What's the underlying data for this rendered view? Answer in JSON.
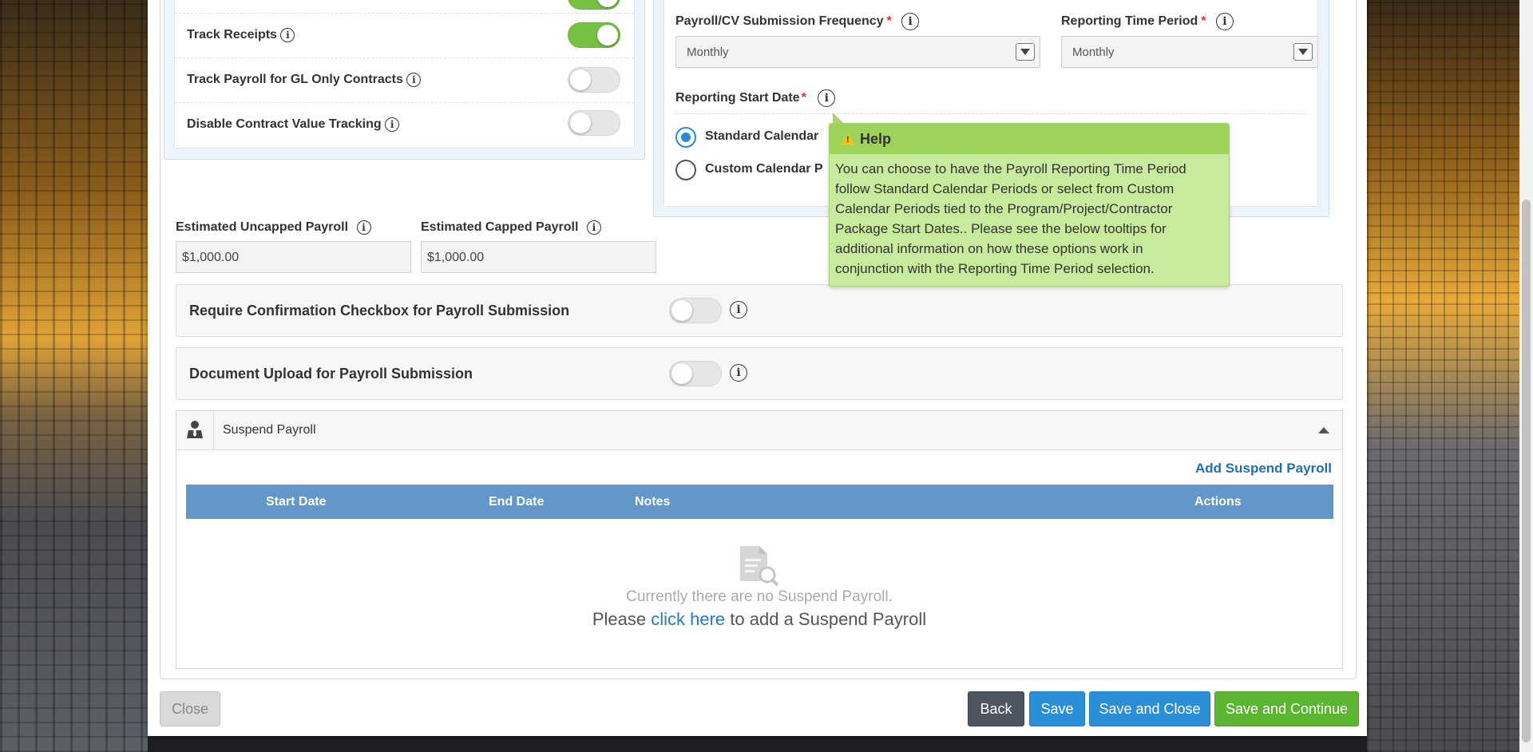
{
  "settings_toggles": [
    {
      "label": "Track Receipts",
      "on": true
    },
    {
      "label": "Track Payroll for GL Only Contracts",
      "on": false
    },
    {
      "label": "Disable Contract Value Tracking",
      "on": false
    }
  ],
  "submission_frequency": {
    "label": "Payroll/CV Submission Frequency",
    "value": "Monthly",
    "required_mark": "*"
  },
  "reporting_time_period": {
    "label": "Reporting Time Period",
    "value": "Monthly",
    "required_mark": "*"
  },
  "reporting_start_date": {
    "label": "Reporting Start Date",
    "required_mark": "*",
    "options": [
      {
        "label": "Standard Calendar",
        "checked": true
      },
      {
        "label": "Custom Calendar P",
        "checked": false
      }
    ]
  },
  "payroll_estimates": {
    "uncapped_label": "Estimated Uncapped Payroll",
    "uncapped_value": "$1,000.00",
    "capped_label": "Estimated Capped Payroll",
    "capped_value": "$1,000.00"
  },
  "require_confirmation": {
    "label": "Require Confirmation Checkbox for Payroll Submission",
    "on": false
  },
  "document_upload": {
    "label": "Document Upload for Payroll Submission",
    "on": false
  },
  "suspend_payroll": {
    "title": "Suspend Payroll",
    "add_label": "Add Suspend Payroll",
    "columns": [
      "Start Date",
      "End Date",
      "Notes",
      "Actions"
    ],
    "empty_message": "Currently there are no Suspend Payroll.",
    "empty_prompt_prefix": "Please",
    "empty_prompt_link": "click here",
    "empty_prompt_suffix": "to add a Suspend Payroll"
  },
  "help_tooltip": {
    "title": "Help",
    "body": "You can choose to have the Payroll Reporting Time Period follow Standard Calendar Periods or select from Custom Calendar Periods tied to the Program/Project/Contractor Package Start Dates.. Please see the below tooltips for additional information on how these options work in conjunction with the Reporting Time Period selection."
  },
  "footer": {
    "close_label": "Close",
    "back_label": "Back",
    "save_label": "Save",
    "save_close_label": "Save and Close",
    "save_continue_label": "Save and Continue"
  },
  "colors": {
    "toggle_on": "#76c043",
    "table_header": "#6497c9",
    "save_blue": "#2a8fd6",
    "continue_green": "#5cb531",
    "tooltip_bg": "#c7ea9c"
  }
}
